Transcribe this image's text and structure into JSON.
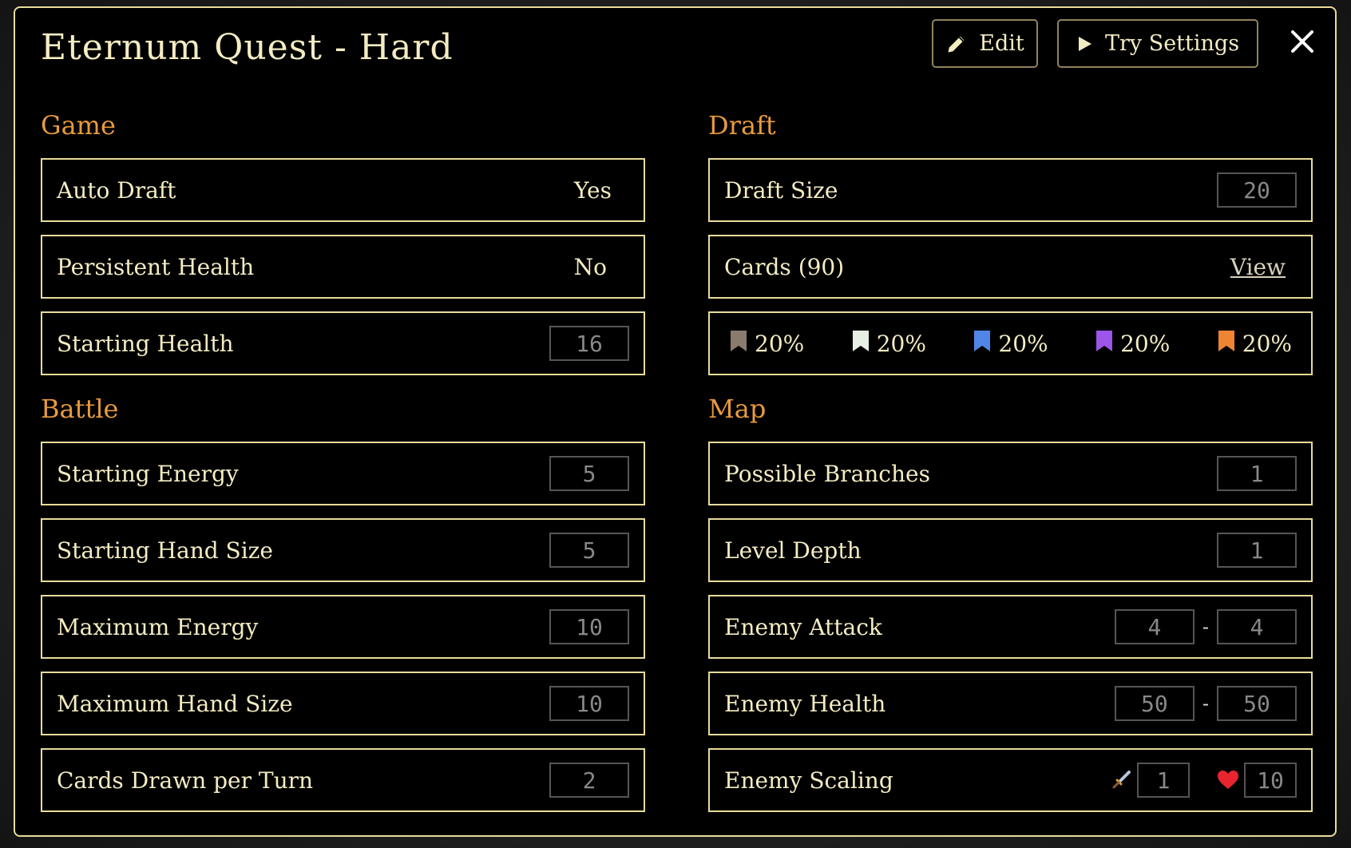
{
  "title": "Eternum Quest - Hard",
  "header": {
    "edit_label": "Edit",
    "try_label": "Try Settings"
  },
  "sections": {
    "game": "Game",
    "battle": "Battle",
    "draft": "Draft",
    "map": "Map"
  },
  "game": {
    "auto_draft": {
      "label": "Auto Draft",
      "value": "Yes"
    },
    "persistent_health": {
      "label": "Persistent Health",
      "value": "No"
    },
    "starting_health": {
      "label": "Starting Health",
      "value": "16"
    }
  },
  "battle": {
    "starting_energy": {
      "label": "Starting Energy",
      "value": "5"
    },
    "starting_hand_size": {
      "label": "Starting Hand Size",
      "value": "5"
    },
    "maximum_energy": {
      "label": "Maximum Energy",
      "value": "10"
    },
    "maximum_hand_size": {
      "label": "Maximum Hand Size",
      "value": "10"
    },
    "cards_drawn": {
      "label": "Cards Drawn per Turn",
      "value": "2"
    }
  },
  "draft": {
    "draft_size": {
      "label": "Draft Size",
      "value": "20"
    },
    "cards": {
      "label": "Cards (90)",
      "link": "View"
    },
    "rarities": [
      {
        "name": "common",
        "color": "#8a7c6c",
        "value": "20%"
      },
      {
        "name": "uncommon",
        "color": "#e6f0e4",
        "value": "20%"
      },
      {
        "name": "rare",
        "color": "#4f86e8",
        "value": "20%"
      },
      {
        "name": "epic",
        "color": "#9b55e8",
        "value": "20%"
      },
      {
        "name": "legendary",
        "color": "#ee8533",
        "value": "20%"
      }
    ]
  },
  "map": {
    "possible_branches": {
      "label": "Possible Branches",
      "value": "1"
    },
    "level_depth": {
      "label": "Level Depth",
      "value": "1"
    },
    "enemy_attack": {
      "label": "Enemy Attack",
      "min": "4",
      "max": "4"
    },
    "enemy_health": {
      "label": "Enemy Health",
      "min": "50",
      "max": "50"
    },
    "enemy_scaling": {
      "label": "Enemy Scaling",
      "attack": "1",
      "health": "10"
    }
  },
  "dash": "-",
  "colors": {
    "border": "#e8dc9a",
    "section": "#e99a3d",
    "text": "#f4ecc2",
    "heart": "#e8252e"
  }
}
